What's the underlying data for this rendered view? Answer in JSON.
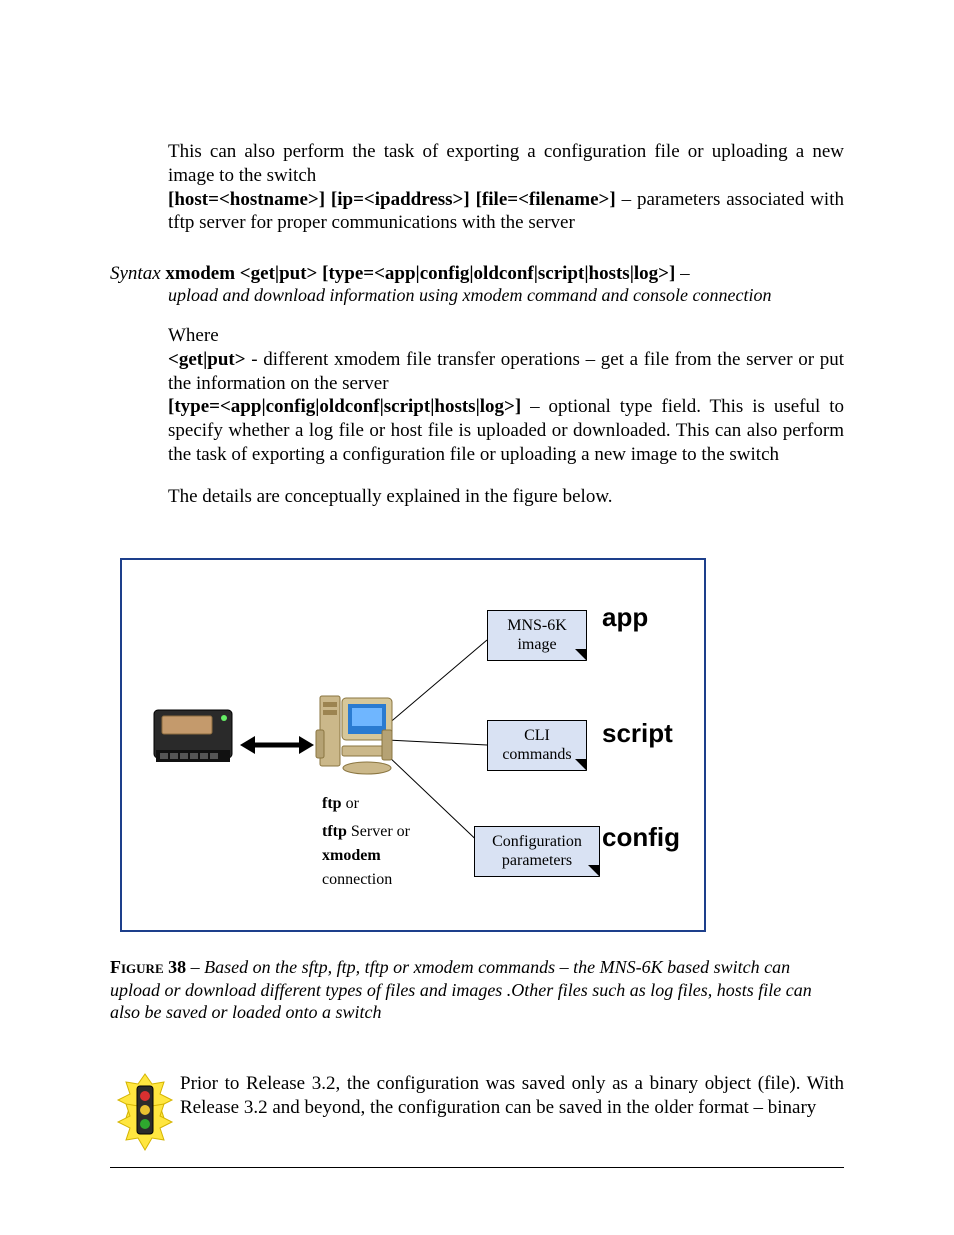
{
  "top_block": {
    "p1": "This can also perform the task of exporting a configuration file or uploading a new image to the switch",
    "p2a": "[host=<hostname>]  [ip=<ipaddress>]  [file=<filename>]",
    "p2b": " – parameters associated with tftp server for proper communications with the server"
  },
  "syntax": {
    "label": "Syntax",
    "cmd": " xmodem <get|put> [type=<app|config|oldconf|script|hosts|log>]",
    "dash": " –",
    "desc": "upload and download information using xmodem command and console connection"
  },
  "where": {
    "title": "Where",
    "l1a": "<get|put>",
    "l1b": " - different xmodem file transfer operations – get a file from the server or put the information on the server",
    "l2a": "[type=<app|config|oldconf|script|hosts|log>]",
    "l2b": " – optional type field. This is useful to specify whether a log file or host file is uploaded or downloaded. This can also perform the task of exporting a configuration file or uploading a new image to the switch"
  },
  "after_where": "The details are conceptually explained in the figure below.",
  "figure": {
    "box1": "MNS-6K image",
    "box2": "CLI commands",
    "box3": "Configuration parameters",
    "label1": "app",
    "label2": "script",
    "label3": "config",
    "server": {
      "l1a": "ftp",
      "l1b": " or",
      "l2a": "tftp",
      "l2b": " Server  or",
      "l3a": "xmodem",
      "l4": "connection"
    }
  },
  "caption": {
    "fignum": "Figure 38",
    "text": " – Based on the sftp, ftp, tftp or xmodem commands – the MNS-6K based switch can upload or download different types of files and images .Other files such as log files, hosts file can also be saved or loaded onto a switch"
  },
  "footer": {
    "text": "Prior to Release 3.2, the configuration was saved only as a binary object (file). With Release 3.2 and beyond, the configuration can be saved in the older format – binary"
  }
}
